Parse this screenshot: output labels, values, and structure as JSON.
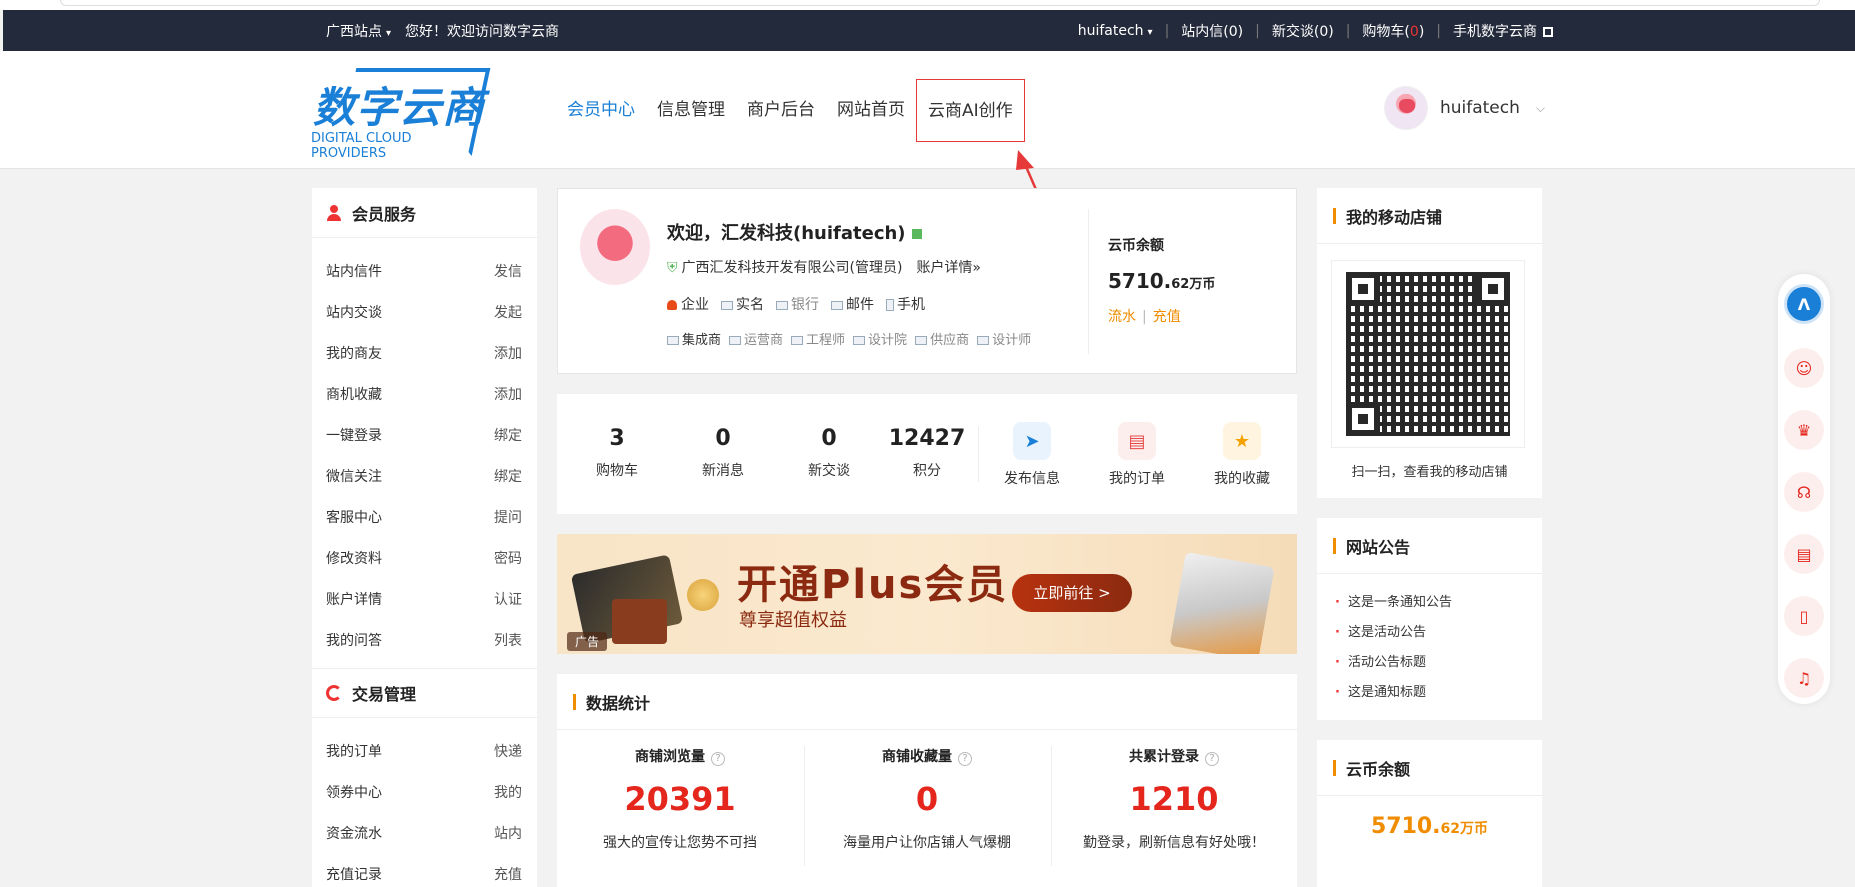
{
  "topbar": {
    "region": "广西站点",
    "greeting": "您好！欢迎访问数字云商",
    "username": "huifatech",
    "inbox": "站内信(0)",
    "chat": "新交谈(0)",
    "cart_prefix": "购物车(",
    "cart_count": "0",
    "cart_suffix": ")",
    "mobile": "手机数字云商"
  },
  "logo": {
    "cn": "数字云商",
    "en": "DIGITAL CLOUD PROVIDERS"
  },
  "nav": [
    {
      "label": "会员中心"
    },
    {
      "label": "信息管理"
    },
    {
      "label": "商户后台"
    },
    {
      "label": "网站首页"
    },
    {
      "label": "云商AI创作"
    }
  ],
  "header_user": {
    "name": "huifatech"
  },
  "sidebar": {
    "member_title": "会员服务",
    "member_items": [
      {
        "label": "站内信件",
        "action": "发信"
      },
      {
        "label": "站内交谈",
        "action": "发起"
      },
      {
        "label": "我的商友",
        "action": "添加"
      },
      {
        "label": "商机收藏",
        "action": "添加"
      },
      {
        "label": "一键登录",
        "action": "绑定"
      },
      {
        "label": "微信关注",
        "action": "绑定"
      },
      {
        "label": "客服中心",
        "action": "提问"
      },
      {
        "label": "修改资料",
        "action": "密码"
      },
      {
        "label": "账户详情",
        "action": "认证"
      },
      {
        "label": "我的问答",
        "action": "列表"
      }
    ],
    "trade_title": "交易管理",
    "trade_items": [
      {
        "label": "我的订单",
        "action": "快递"
      },
      {
        "label": "领券中心",
        "action": "我的"
      },
      {
        "label": "资金流水",
        "action": "站内"
      },
      {
        "label": "充值记录",
        "action": "充值"
      }
    ]
  },
  "welcome": {
    "hello": "欢迎，汇发科技(huifatech)",
    "company": "广西汇发科技开发有限公司(管理员)",
    "account_link": "账户详情»",
    "certs": [
      {
        "label": "企业",
        "active": true
      },
      {
        "label": "实名",
        "active": true
      },
      {
        "label": "银行",
        "active": false
      },
      {
        "label": "邮件",
        "active": true
      },
      {
        "label": "手机",
        "active": true
      }
    ],
    "roles": [
      "集成商",
      "运营商",
      "工程师",
      "设计院",
      "供应商",
      "设计师"
    ],
    "coin_label": "云币余额",
    "coin_value": "5710.",
    "coin_unit": "62万币",
    "flow": "流水",
    "recharge": "充值"
  },
  "stats": [
    {
      "num": "3",
      "label": "购物车"
    },
    {
      "num": "0",
      "label": "新消息"
    },
    {
      "num": "0",
      "label": "新交谈"
    },
    {
      "num": "12427",
      "label": "积分"
    }
  ],
  "quick_actions": [
    {
      "label": "发布信息",
      "icon": "paper-plane-icon"
    },
    {
      "label": "我的订单",
      "icon": "clipboard-icon"
    },
    {
      "label": "我的收藏",
      "icon": "star-icon"
    }
  ],
  "banner": {
    "title": "开通Plus会员",
    "subtitle": "尊享超值权益",
    "button": "立即前往 >",
    "ad": "广告"
  },
  "datastat": {
    "title": "数据统计",
    "metrics": [
      {
        "title": "商铺浏览量",
        "value": "20391",
        "desc": "强大的宣传让您势不可挡"
      },
      {
        "title": "商铺收藏量",
        "value": "0",
        "desc": "海量用户让你店铺人气爆棚"
      },
      {
        "title": "共累计登录",
        "value": "1210",
        "desc": "勤登录，刷新信息有好处哦！"
      }
    ]
  },
  "right": {
    "shop_title": "我的移动店铺",
    "qr_caption": "扫一扫，查看我的移动店铺",
    "notice_title": "网站公告",
    "notices": [
      "这是一条通知公告",
      "这是活动公告",
      "活动公告标题",
      "这是通知标题"
    ],
    "coin_title": "云币余额",
    "coin_value": "5710.",
    "coin_unit": "62万币"
  },
  "colors": {
    "brand": "#1a7fd6",
    "accent_red": "#e4261c",
    "orange": "#f08c00",
    "topbar": "#232a3b"
  }
}
